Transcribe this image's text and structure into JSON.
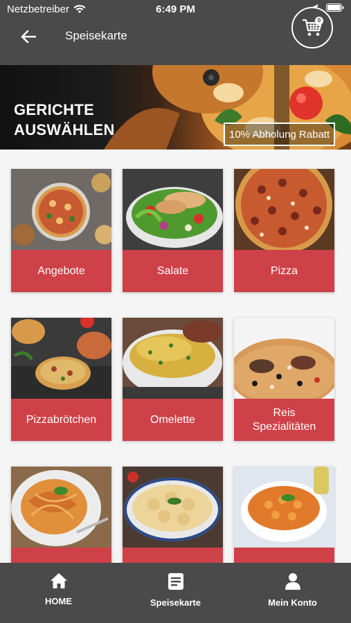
{
  "status": {
    "carrier": "Netzbetreiber",
    "time": "6:49 PM"
  },
  "header": {
    "title": "Speisekarte",
    "cart_count": "0"
  },
  "banner": {
    "title_line1": "GERICHTE",
    "title_line2": "AUSWÄHLEN",
    "rabatt": "10% Abholung Rabatt"
  },
  "categories": [
    {
      "label": "Angebote"
    },
    {
      "label": "Salate"
    },
    {
      "label": "Pizza"
    },
    {
      "label": "Pizzabrötchen"
    },
    {
      "label": "Omelette"
    },
    {
      "label": "Reis\nSpezialitäten"
    },
    {
      "label": ""
    },
    {
      "label": ""
    },
    {
      "label": ""
    }
  ],
  "tabs": [
    {
      "label": "HOME",
      "icon": "home-icon"
    },
    {
      "label": "Speisekarte",
      "icon": "menu-list-icon"
    },
    {
      "label": "Mein Konto",
      "icon": "account-icon"
    }
  ],
  "colors": {
    "bar": "#4a4a4a",
    "accent": "#cf4148"
  }
}
